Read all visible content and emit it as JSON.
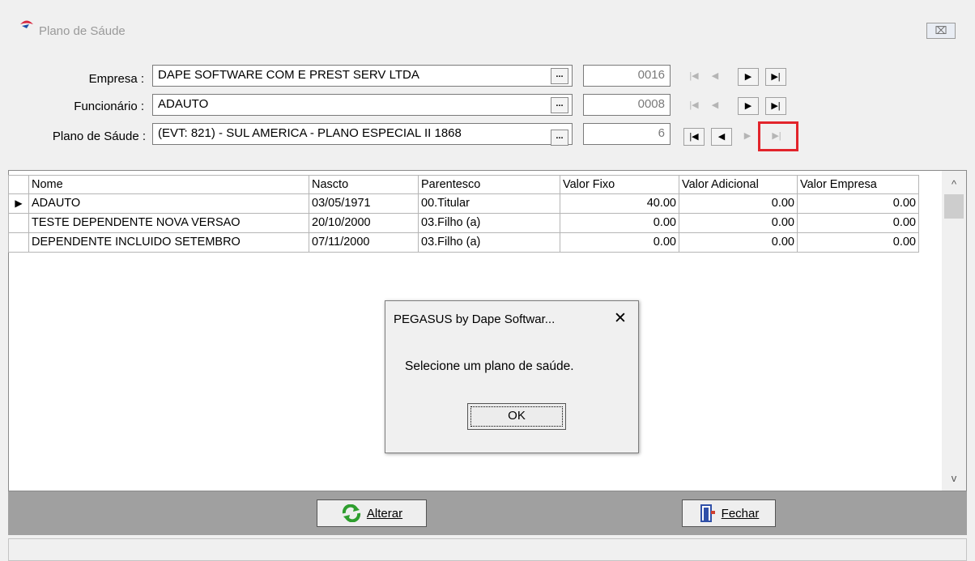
{
  "window": {
    "title": "Plano de Sáude",
    "close_label": "⌧"
  },
  "form": {
    "empresa": {
      "label": "Empresa :",
      "value": "DAPE SOFTWARE COM E PREST SERV LTDA",
      "code": "0016"
    },
    "funcionario": {
      "label": "Funcionário :",
      "value": "ADAUTO",
      "code": "0008"
    },
    "plano": {
      "label": "Plano de Sáude :",
      "value": "(EVT: 821) - SUL AMERICA - PLANO ESPECIAL II 1868",
      "code": "6"
    },
    "lookup_label": "...",
    "nav_glyphs": {
      "first": "⏮",
      "prev": "◀",
      "next": "▶",
      "last": "⏭",
      "first_alt": "|◀",
      "last_alt": "▶|"
    }
  },
  "grid": {
    "columns": [
      "Nome",
      "Nascto",
      "Parentesco",
      "Valor Fixo",
      "Valor Adicional",
      "Valor Empresa"
    ],
    "rows": [
      [
        "ADAUTO",
        "03/05/1971",
        "00.Titular",
        "40.00",
        "0.00",
        "0.00"
      ],
      [
        "TESTE DEPENDENTE NOVA VERSAO",
        "20/10/2000",
        "03.Filho (a)",
        "0.00",
        "0.00",
        "0.00"
      ],
      [
        "DEPENDENTE INCLUIDO SETEMBRO",
        "07/11/2000",
        "03.Filho (a)",
        "0.00",
        "0.00",
        "0.00"
      ]
    ],
    "current_row_marker": "▶",
    "scroll_up": "^",
    "scroll_down": "v"
  },
  "buttons": {
    "alterar": "Alterar",
    "fechar": "Fechar"
  },
  "dialog": {
    "title": "PEGASUS by Dape Softwar...",
    "close": "✕",
    "message": "Selecione um plano de saúde.",
    "ok": "OK"
  },
  "colors": {
    "highlight": "#e2242b",
    "button_bar": "#a0a0a0",
    "alterar_icon": "#2e9e2e",
    "fechar_icon": "#3050a8"
  }
}
